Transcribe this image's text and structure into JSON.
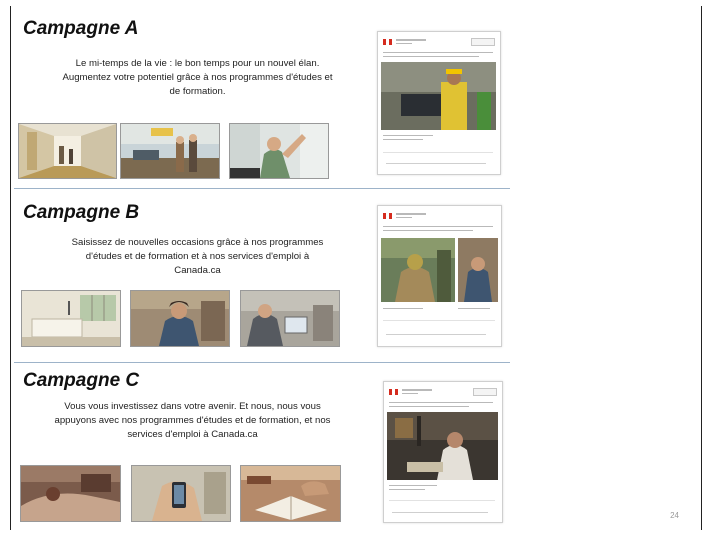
{
  "campaigns": [
    {
      "title": "Campagne A",
      "desc_lines": [
        "Le mi-temps de la vie : le bon temps pour un nouvel élan.",
        "Augmentez votre potentiel grâce à nos programmes d'études et",
        "de formation."
      ]
    },
    {
      "title": "Campagne B",
      "desc_lines": [
        "Saisissez de nouvelles occasions grâce à nos programmes",
        "d'études et de formation et à nos services d'emploi à",
        "Canada.ca"
      ]
    },
    {
      "title": "Campagne C",
      "desc_lines": [
        "Vous vous investissez dans votre avenir. Et nous, nous vous",
        "appuyons avec nos programmes d'études et de formation,  et nos",
        "services d'emploi à Canada.ca"
      ]
    }
  ],
  "page_number": "24"
}
